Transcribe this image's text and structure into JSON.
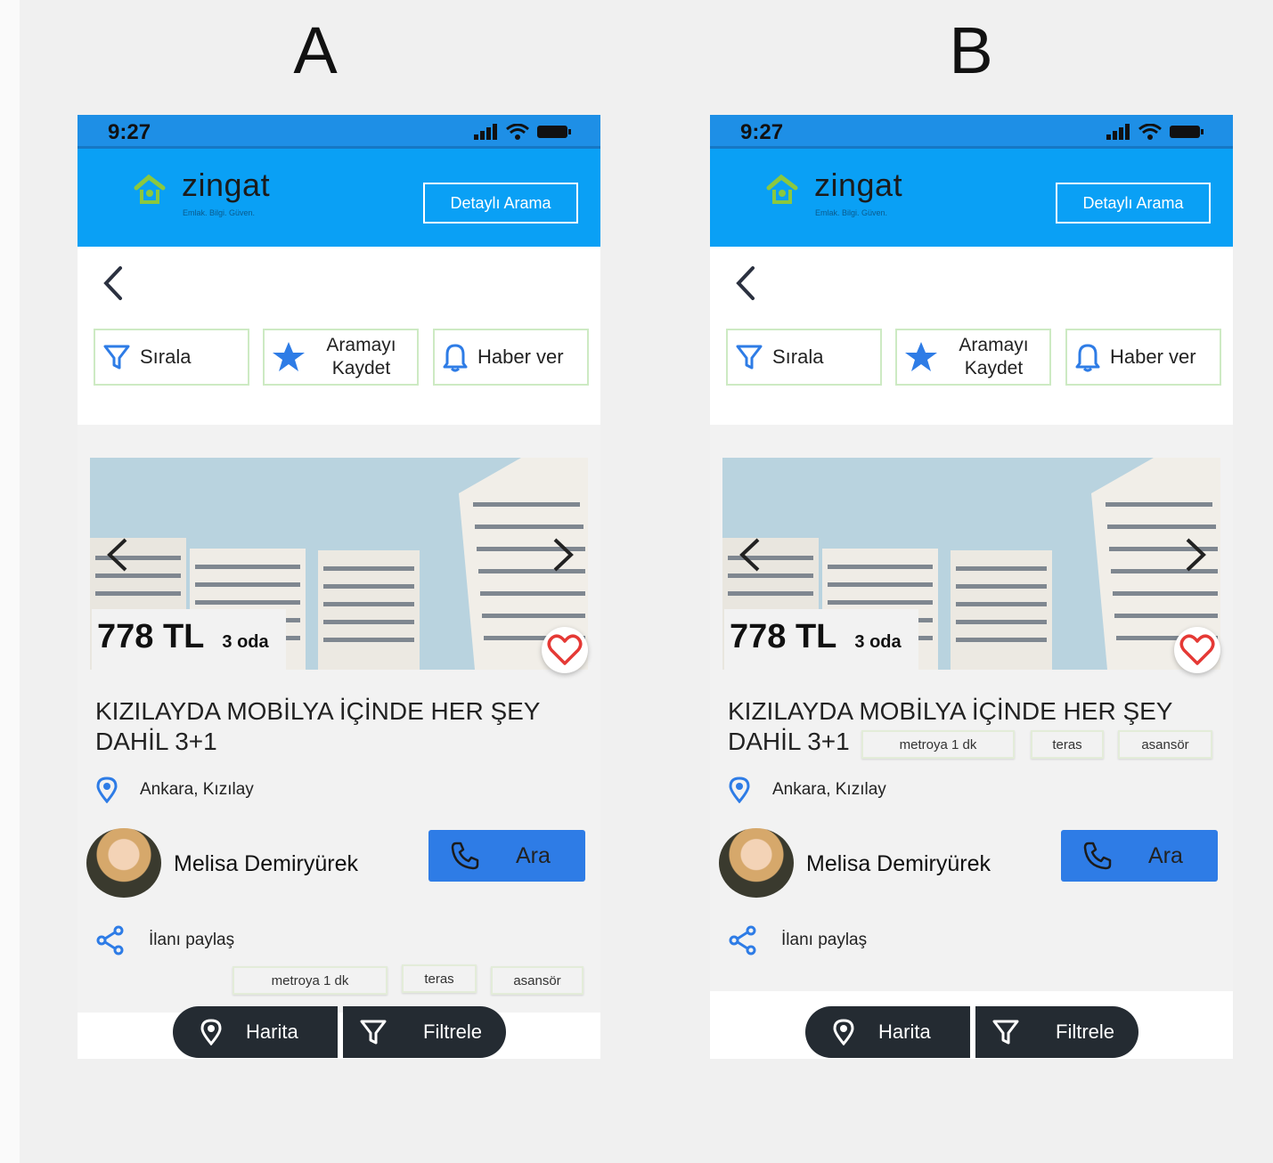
{
  "variants": [
    {
      "label": "A",
      "status_time": "9:27",
      "brand": "zingat",
      "tagline": "Emlak. Bilgi. Güven.",
      "detail_search": "Detaylı Arama",
      "actions": {
        "sort": "Sırala",
        "save_line1": "Aramayı",
        "save_line2": "Kaydet",
        "notify": "Haber ver"
      },
      "listing": {
        "price": "778 TL",
        "rooms": "3 oda",
        "title_line1": "KIZILAYDA MOBİLYA İÇİNDE HER ŞEY",
        "title_line2": "DAHİL 3+1",
        "location": "Ankara, Kızılay",
        "agent": "Melisa Demiryürek",
        "call": "Ara",
        "share": "İlanı paylaş",
        "tags": [
          "metroya 1 dk",
          "teras",
          "asansör"
        ]
      },
      "bottom_nav": {
        "map": "Harita",
        "filter": "Filtrele"
      }
    },
    {
      "label": "B",
      "status_time": "9:27",
      "brand": "zingat",
      "tagline": "Emlak. Bilgi. Güven.",
      "detail_search": "Detaylı Arama",
      "actions": {
        "sort": "Sırala",
        "save_line1": "Aramayı",
        "save_line2": "Kaydet",
        "notify": "Haber ver"
      },
      "listing": {
        "price": "778 TL",
        "rooms": "3 oda",
        "title_line1": "KIZILAYDA MOBİLYA İÇİNDE HER ŞEY",
        "title_line2": "DAHİL 3+1",
        "location": "Ankara, Kızılay",
        "agent": "Melisa Demiryürek",
        "call": "Ara",
        "share": "İlanı paylaş",
        "tags": [
          "metroya 1 dk",
          "teras",
          "asansör"
        ]
      },
      "bottom_nav": {
        "map": "Harita",
        "filter": "Filtrele"
      }
    }
  ],
  "colors": {
    "app_bar": "#0aa0f5",
    "status_bar": "#1e8fe6",
    "call_button": "#2e7ce6",
    "logo_green": "#8bc83f",
    "button_border": "#cdeac3",
    "bottom_nav": "#242b32",
    "heart": "#e53935"
  },
  "icons": [
    "signal-icon",
    "wifi-icon",
    "battery-icon",
    "zingat-logo-icon",
    "back-arrow-icon",
    "filter-icon",
    "star-icon",
    "bell-icon",
    "heart-icon",
    "location-pin-icon",
    "phone-icon",
    "share-icon",
    "map-pin-icon",
    "funnel-icon"
  ]
}
